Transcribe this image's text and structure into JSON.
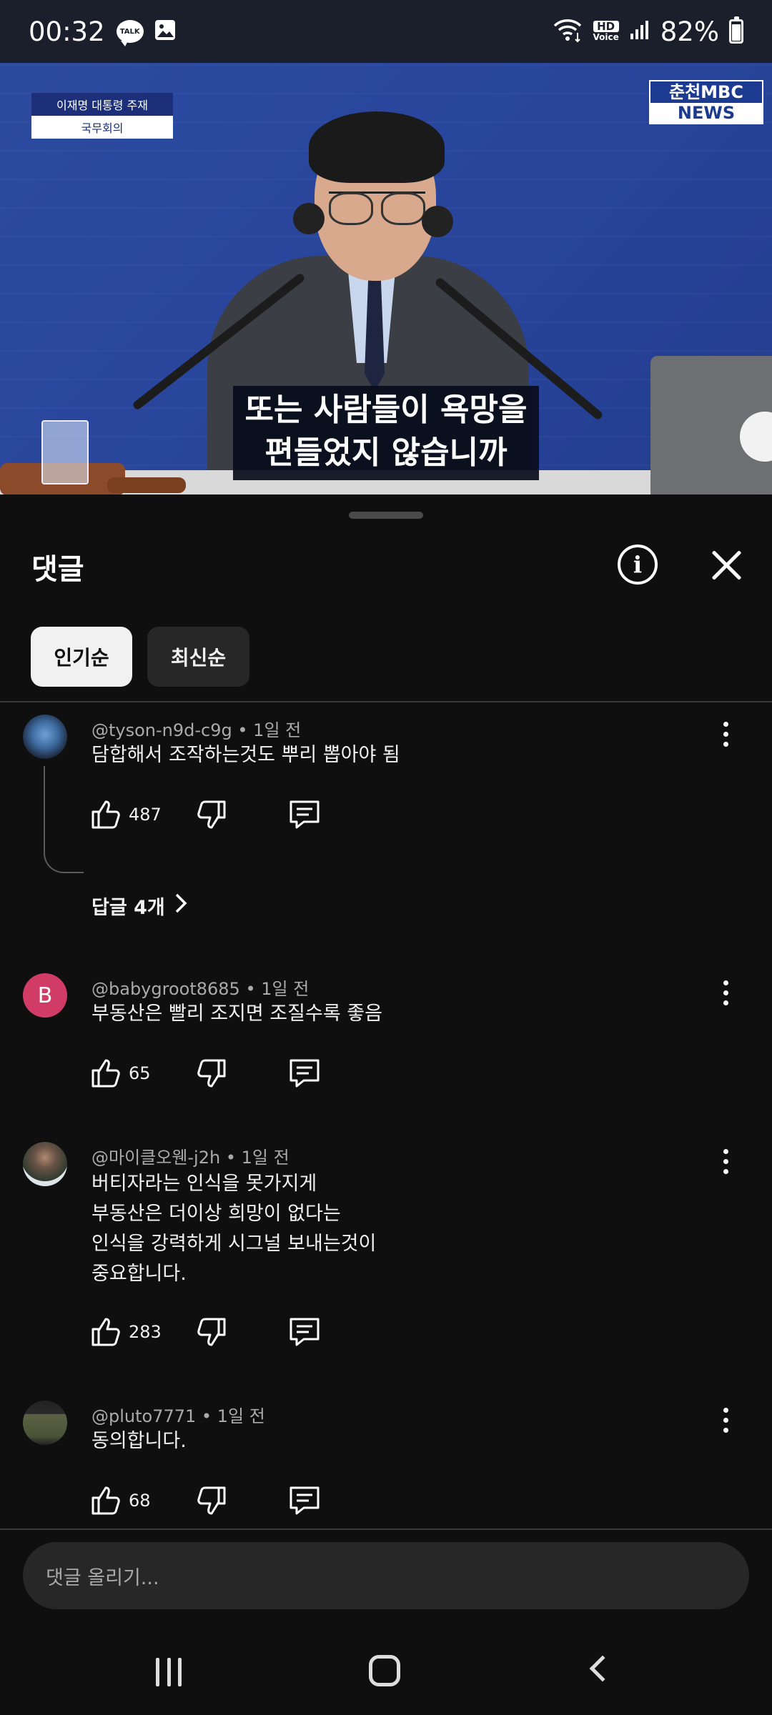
{
  "status_bar": {
    "time": "00:32",
    "talk_label": "TALK",
    "hd_top": "HD",
    "hd_bottom": "Voice",
    "battery_pct": "82%",
    "battery_level": 0.82
  },
  "video": {
    "caption_tag_line1": "이재명 대통령 주재",
    "caption_tag_line2": "국무회의",
    "logo_line1": "춘천MBC",
    "logo_line2": "NEWS",
    "subtitle_line1": "또는 사람들이 욕망을",
    "subtitle_line2": "편들었지 않습니까"
  },
  "sheet": {
    "title": "댓글",
    "info_label": "i",
    "sort_chips": [
      {
        "label": "인기순",
        "selected": true
      },
      {
        "label": "최신순",
        "selected": false
      }
    ]
  },
  "comments": [
    {
      "handle": "@tyson-n9d-c9g",
      "time": "1일 전",
      "lines": [
        "담합해서 조작하는것도 뿌리 뽑아야 됨"
      ],
      "likes": "487",
      "replies_label": "답글 4개",
      "avatar": "blue-creature-avatar"
    },
    {
      "handle": "@babygroot8685",
      "time": "1일 전",
      "lines": [
        "부동산은 빨리 조지면 조질수록 좋음"
      ],
      "likes": "65",
      "avatar_letter": "B"
    },
    {
      "handle": "@마이클오웬-j2h",
      "time": "1일 전",
      "lines": [
        "버티자라는 인식을 못가지게",
        "부동산은 더이상 희망이 없다는",
        "인식을 강력하게 시그널 보내는것이",
        "중요합니다."
      ],
      "likes": "283",
      "avatar": "man-portrait-avatar"
    },
    {
      "handle": "@pluto7771",
      "time": "1일 전",
      "lines": [
        "동의합니다."
      ],
      "likes": "68",
      "avatar": "soldier-figure-avatar"
    }
  ],
  "composer": {
    "placeholder": "댓글 올리기..."
  },
  "colors": {
    "background": "#0f0f0f",
    "chip_selected": "#f1f1f1",
    "chip_unselected": "#272727",
    "avatar_b": "#d13c66",
    "status_bar": "#1b1e2b"
  }
}
